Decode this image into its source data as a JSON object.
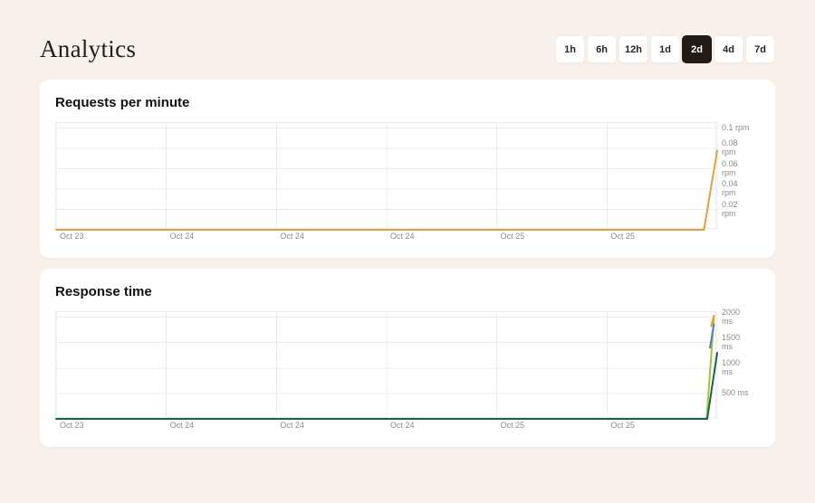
{
  "page": {
    "title": "Analytics"
  },
  "time_range": {
    "options": [
      "1h",
      "6h",
      "12h",
      "1d",
      "2d",
      "4d",
      "7d"
    ],
    "selected": "2d"
  },
  "colors": {
    "page_background": "#f8f0ea",
    "card_background": "#ffffff",
    "selected_button_background": "#211b14",
    "requests_line": "#e2a13c",
    "response_line_green": "#186349",
    "response_line_lime": "#a4c438",
    "response_line_blue": "#4d7cc9",
    "response_line_orange": "#e59a2f"
  },
  "chart_data": [
    {
      "type": "line",
      "title": "Requests per minute",
      "unit": "rpm",
      "grid": true,
      "legend": "none",
      "x_tick_labels": [
        "Oct 23",
        "Oct 24",
        "Oct 24",
        "Oct 24",
        "Oct 25",
        "Oct 25"
      ],
      "ylim": [
        0,
        0.105
      ],
      "yticks": [
        {
          "value": 0.1,
          "lines": [
            "0.1 rpm"
          ]
        },
        {
          "value": 0.08,
          "lines": [
            "0.08",
            "rpm"
          ]
        },
        {
          "value": 0.06,
          "lines": [
            "0.06",
            "rpm"
          ]
        },
        {
          "value": 0.04,
          "lines": [
            "0.04",
            "rpm"
          ]
        },
        {
          "value": 0.02,
          "lines": [
            "0.02",
            "rpm"
          ]
        }
      ],
      "series": [
        {
          "name": "requests-per-minute",
          "color": "#e2a13c",
          "points": [
            [
              0,
              0
            ],
            [
              0.98,
              0
            ],
            [
              1,
              0.078
            ]
          ]
        }
      ]
    },
    {
      "type": "line",
      "title": "Response time",
      "unit": "ms",
      "grid": true,
      "legend": "none",
      "x_tick_labels": [
        "Oct 23",
        "Oct 24",
        "Oct 24",
        "Oct 24",
        "Oct 25",
        "Oct 25"
      ],
      "ylim": [
        0,
        2100
      ],
      "yticks": [
        {
          "value": 2000,
          "lines": [
            "2000",
            "ms"
          ]
        },
        {
          "value": 1500,
          "lines": [
            "1500",
            "ms"
          ]
        },
        {
          "value": 1000,
          "lines": [
            "1000",
            "ms"
          ]
        },
        {
          "value": 500,
          "lines": [
            "500 ms"
          ]
        }
      ],
      "series": [
        {
          "name": "response-time-lime",
          "color": "#a4c438",
          "points": [
            [
              0.984,
              0
            ],
            [
              0.995,
              1980
            ]
          ]
        },
        {
          "name": "response-time-blue",
          "color": "#4d7cc9",
          "points": [
            [
              0.989,
              1400
            ],
            [
              0.995,
              1860
            ]
          ]
        },
        {
          "name": "response-time-orange",
          "color": "#e59a2f",
          "points": [
            [
              0.991,
              1820
            ],
            [
              0.995,
              2030
            ]
          ]
        },
        {
          "name": "response-time-green",
          "color": "#186349",
          "points": [
            [
              0,
              0
            ],
            [
              0.985,
              0
            ],
            [
              1,
              1300
            ]
          ]
        }
      ]
    }
  ]
}
